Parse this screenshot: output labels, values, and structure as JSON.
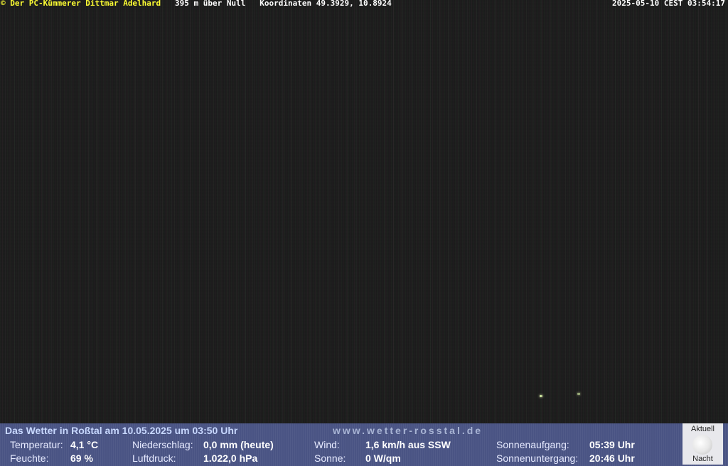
{
  "overlay": {
    "copyright_symbol": "©",
    "owner": "Der PC-Kümmerer Dittmar Adelhard",
    "altitude": "395 m über Null",
    "coordinates": "Koordinaten 49.3929, 10.8924",
    "timestamp": "2025-05-10 CEST 03:54:17"
  },
  "weather": {
    "headline": "Das Wetter in Roßtal am 10.05.2025 um 03:50 Uhr",
    "site_url": "www.wetter-rosstal.de",
    "temperature_label": "Temperatur:",
    "temperature_value": "4,1 °C",
    "humidity_label": "Feuchte:",
    "humidity_value": "69 %",
    "precipitation_label": "Niederschlag:",
    "precipitation_value": "0,0 mm (heute)",
    "pressure_label": "Luftdruck:",
    "pressure_value": "1.022,0 hPa",
    "wind_label": "Wind:",
    "wind_value": "1,6 km/h aus SSW",
    "sun_label": "Sonne:",
    "sun_value": "0 W/qm",
    "sunrise_label": "Sonnenaufgang:",
    "sunrise_value": "05:39 Uhr",
    "sunset_label": "Sonnenuntergang:",
    "sunset_value": "20:46 Uhr"
  },
  "moon": {
    "label_top": "Aktuell",
    "label_bottom": "Nacht",
    "icon": "full-moon-icon"
  }
}
